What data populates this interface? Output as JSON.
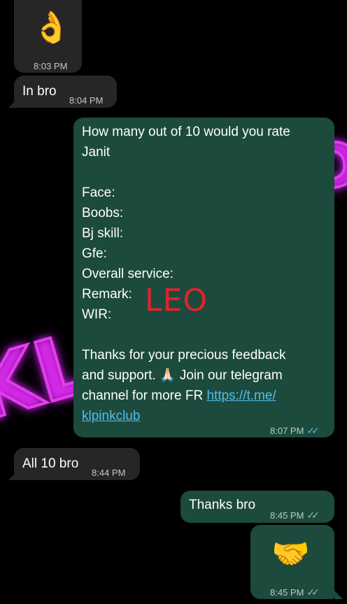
{
  "messages": [
    {
      "type": "in",
      "emoji": "👌",
      "time": "8:03 PM"
    },
    {
      "type": "in",
      "text": "In bro",
      "time": "8:04 PM"
    },
    {
      "type": "out",
      "text": "How many out of 10 would you rate\nJanit\n\nFace:\nBoobs:\nBj skill:\nGfe:\nOverall service:\nRemark:\nWIR:\n\nThanks for your precious feedback\nand support. 🙏🏻 Join our telegram\nchannel for more FR ",
      "link": "https://t.me/\nklpinkclub",
      "handwritten": "LEO",
      "time": "8:07 PM",
      "read_status": "read"
    },
    {
      "type": "in",
      "text": "All 10 bro",
      "time": "8:44 PM"
    },
    {
      "type": "out",
      "text": "Thanks bro",
      "time": "8:45 PM",
      "read_status": "delivered"
    },
    {
      "type": "out",
      "emoji": "🤝",
      "time": "8:45 PM",
      "read_status": "delivered"
    }
  ],
  "colors": {
    "incoming_bubble": "#262626",
    "outgoing_bubble": "#1c4a3d",
    "read_tick": "#53bdeb",
    "link": "#53bdeb",
    "handwriting": "#e0242a",
    "neon_background": "#e43cf0"
  },
  "icons": {
    "read": "double-check-icon",
    "delivered": "double-check-icon"
  }
}
